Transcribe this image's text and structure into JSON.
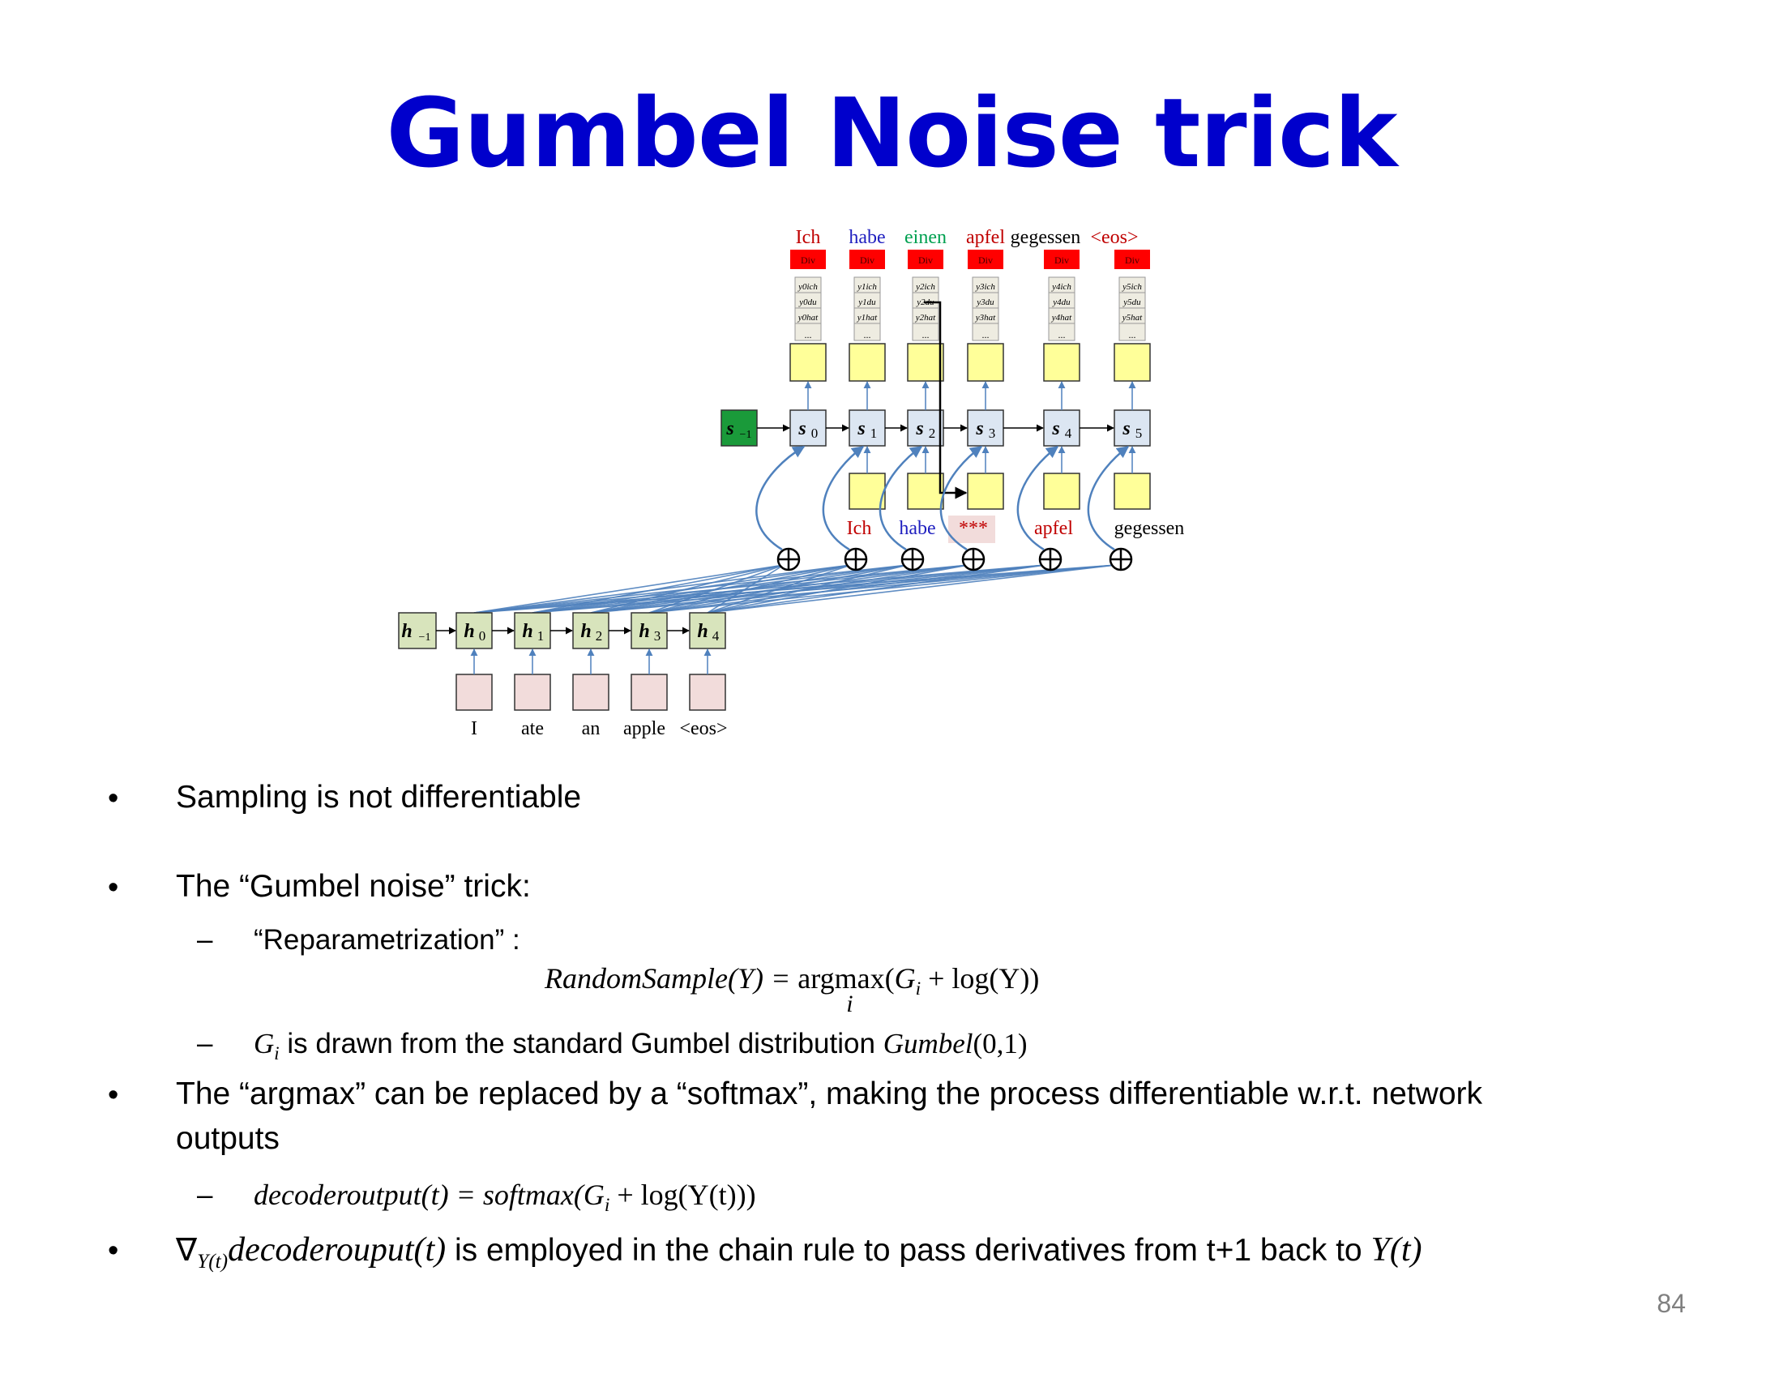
{
  "slide": {
    "title": "Gumbel Noise trick",
    "page_number": "84"
  },
  "diagram": {
    "output_words": [
      {
        "text": "Ich",
        "color": "#c00000"
      },
      {
        "text": "habe",
        "color": "#1f1fbf"
      },
      {
        "text": "einen",
        "color": "#00a050"
      },
      {
        "text": "apfel",
        "color": "#c00000"
      },
      {
        "text": "gegessen",
        "color": "#000000"
      },
      {
        "text": "<eos>",
        "color": "#c00000"
      }
    ],
    "div_label": "Div",
    "dist_entries": [
      [
        "y0ich",
        "y0du",
        "y0hat"
      ],
      [
        "y1ich",
        "y1du",
        "y1hat"
      ],
      [
        "y2ich",
        "y2du",
        "y2hat"
      ],
      [
        "y3ich",
        "y3du",
        "y3hat"
      ],
      [
        "y4ich",
        "y4du",
        "y4hat"
      ],
      [
        "y5ich",
        "y5du",
        "y5hat"
      ]
    ],
    "dist_ellipsis": "...",
    "decoder_states": [
      "s",
      "s",
      "s",
      "s",
      "s",
      "s"
    ],
    "decoder_subscripts": [
      "0",
      "1",
      "2",
      "3",
      "4",
      "5"
    ],
    "decoder_init": {
      "base": "s",
      "sub": "−1"
    },
    "encoder_init": {
      "base": "h",
      "sub": "−1"
    },
    "encoder_subscripts": [
      "0",
      "1",
      "2",
      "3",
      "4"
    ],
    "input_words": [
      "I",
      "ate",
      "an",
      "apple",
      "<eos>"
    ],
    "feedback_words": [
      {
        "text": "Ich",
        "color": "#c00000"
      },
      {
        "text": "habe",
        "color": "#1f1fbf"
      },
      {
        "text": "***",
        "color": "#c00000"
      },
      {
        "text": "apfel",
        "color": "#c00000"
      },
      {
        "text": "gegessen",
        "color": "#000000"
      }
    ],
    "colors": {
      "decoder_init": "#1a9a3a",
      "encoder": "#d8e4bc",
      "decoder": "#dce6f2",
      "output_box": "#ffff99",
      "input_box": "#f2dcdb",
      "div_box": "#ff0000",
      "attention": "#4f81bd",
      "title": "#0000cc"
    }
  },
  "bullets": {
    "b1": "Sampling is not differentiable",
    "b2": "The “Gumbel noise” trick:",
    "b2_sub1": "“Reparametrization” :",
    "eq1_lhs": "RandomSample(Y) = ",
    "eq1_op": "argmax",
    "eq1_under": "i",
    "eq1_rhs": "(G",
    "eq1_rhs_sub": "i",
    "eq1_rhs_tail": " + log(Y))",
    "b2_sub2_var": "G",
    "b2_sub2_var_sub": "i",
    "b2_sub2_text": " is drawn from the standard Gumbel distribution ",
    "b2_sub2_dist": "Gumbel",
    "b2_sub2_args": "(0,1)",
    "b3_line1": "The “argmax” can be replaced by a “softmax”, making the process differentiable w.r.t. network",
    "b3_line2": "outputs",
    "b3_sub_lhs": "decoderoutput(t) = softmax(G",
    "b3_sub_sub": "i",
    "b3_sub_tail": " + log(Y(t)))",
    "b4_nabla": "∇",
    "b4_nabla_sub": "Y(t)",
    "b4_func": "decoderouput(t)",
    "b4_text": " is employed in the chain rule to pass derivatives from t+1 back to ",
    "b4_end": "Y(t)",
    "bullet_mark": "•",
    "dash_mark": "–"
  }
}
